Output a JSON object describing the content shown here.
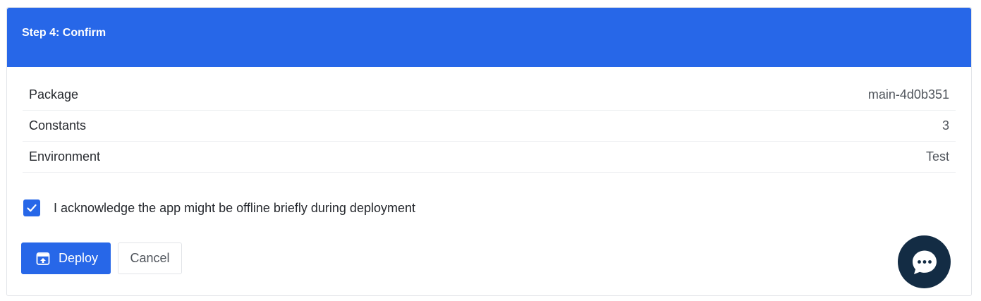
{
  "card": {
    "title": "Step 4: Confirm"
  },
  "summary": {
    "rows": [
      {
        "label": "Package",
        "value": "main-4d0b351"
      },
      {
        "label": "Constants",
        "value": "3"
      },
      {
        "label": "Environment",
        "value": "Test"
      }
    ]
  },
  "acknowledgement": {
    "checked": true,
    "text": "I acknowledge the app might be offline briefly during deployment"
  },
  "actions": {
    "deploy_label": "Deploy",
    "deploy_icon": "deploy-icon",
    "cancel_label": "Cancel"
  },
  "chat": {
    "icon": "chat-bubble-icon"
  },
  "colors": {
    "accent": "#2767e8",
    "chat_fab": "#132c44"
  }
}
